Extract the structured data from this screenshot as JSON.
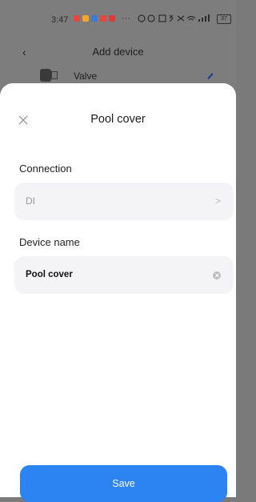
{
  "status_bar": {
    "time": "3:47",
    "more": "···",
    "battery": "37"
  },
  "background_screen": {
    "back_icon": "back-chevron-icon",
    "title": "Add device",
    "row": {
      "label": "Valve",
      "icon": "valve-icon",
      "edit_icon": "edit-pencil-icon"
    }
  },
  "sheet": {
    "title": "Pool cover",
    "close_icon": "close-icon",
    "connection": {
      "label": "Connection",
      "value": "DI",
      "chevron": ">"
    },
    "device_name": {
      "label": "Device name",
      "value": "Pool cover",
      "clear_icon": "clear-icon"
    },
    "save_label": "Save"
  },
  "colors": {
    "primary": "#2b84f2",
    "field_bg": "#f4f4f6",
    "sheet_bg": "#ffffff",
    "dim_overlay": "#7d7d7d",
    "edit_icon": "#1f3d8f"
  }
}
